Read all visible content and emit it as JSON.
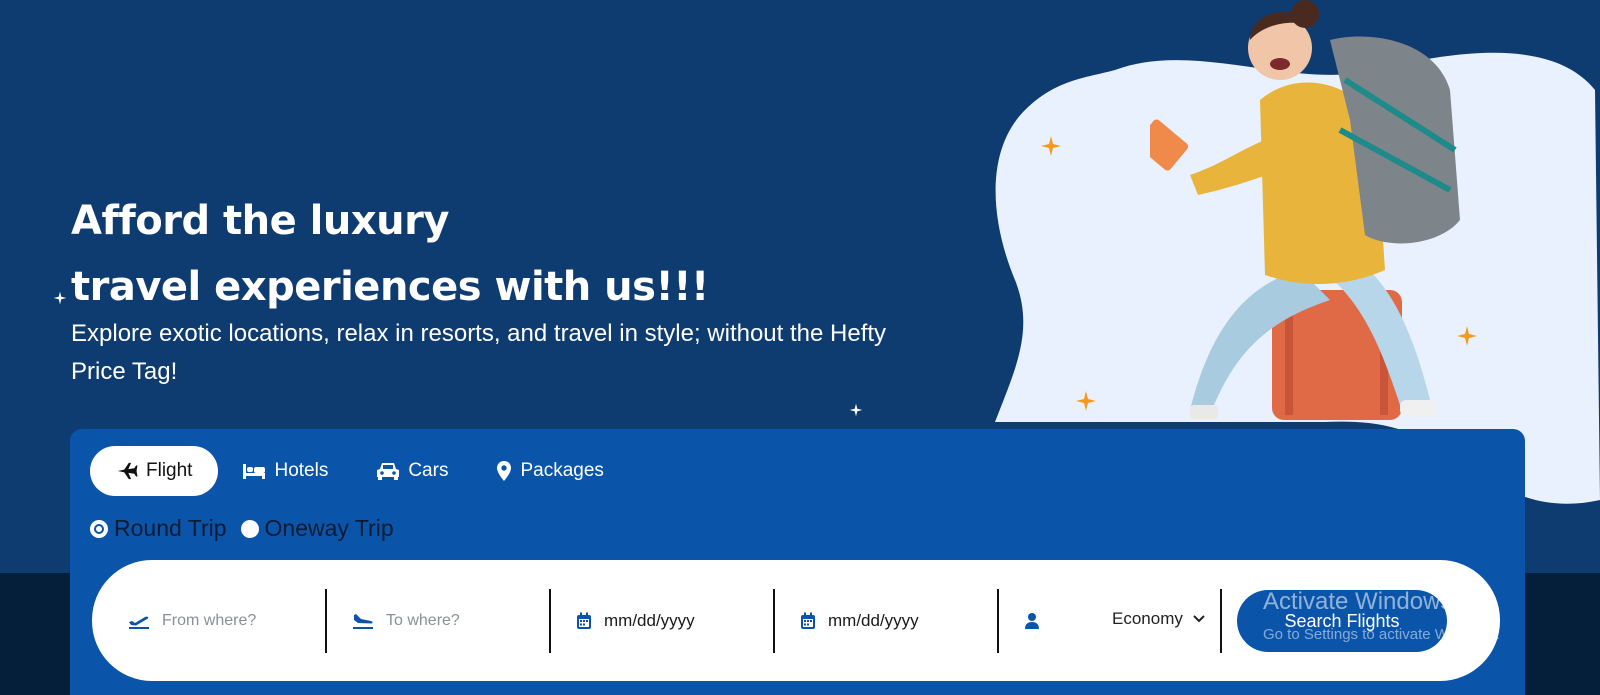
{
  "hero": {
    "headline_line1": "Afford the luxury",
    "headline_line2": "travel experiences with us!!!",
    "subtext": "Explore exotic locations, relax in resorts, and travel in style; without the Hefty Price Tag!"
  },
  "tabs": [
    {
      "label": "Flight",
      "icon": "plane-icon",
      "active": true
    },
    {
      "label": "Hotels",
      "icon": "bed-icon",
      "active": false
    },
    {
      "label": "Cars",
      "icon": "car-icon",
      "active": false
    },
    {
      "label": "Packages",
      "icon": "location-pin-icon",
      "active": false
    }
  ],
  "trip_type": {
    "options": [
      "Round Trip",
      "Oneway Trip"
    ],
    "selected": "Round Trip"
  },
  "search": {
    "from_placeholder": "From where?",
    "to_placeholder": "To where?",
    "depart_date": "mm/dd/yyyy",
    "return_date": "mm/dd/yyyy",
    "cabin_class": "Economy",
    "button_label": "Search Flights"
  },
  "watermark": {
    "title": "Activate Windows",
    "subtitle": "Go to Settings to activate Windows."
  },
  "colors": {
    "hero_bg": "#0f3c70",
    "panel_bg": "#0a55aa",
    "accent_orange": "#f39a1e",
    "blob": "#e8f1fd"
  }
}
